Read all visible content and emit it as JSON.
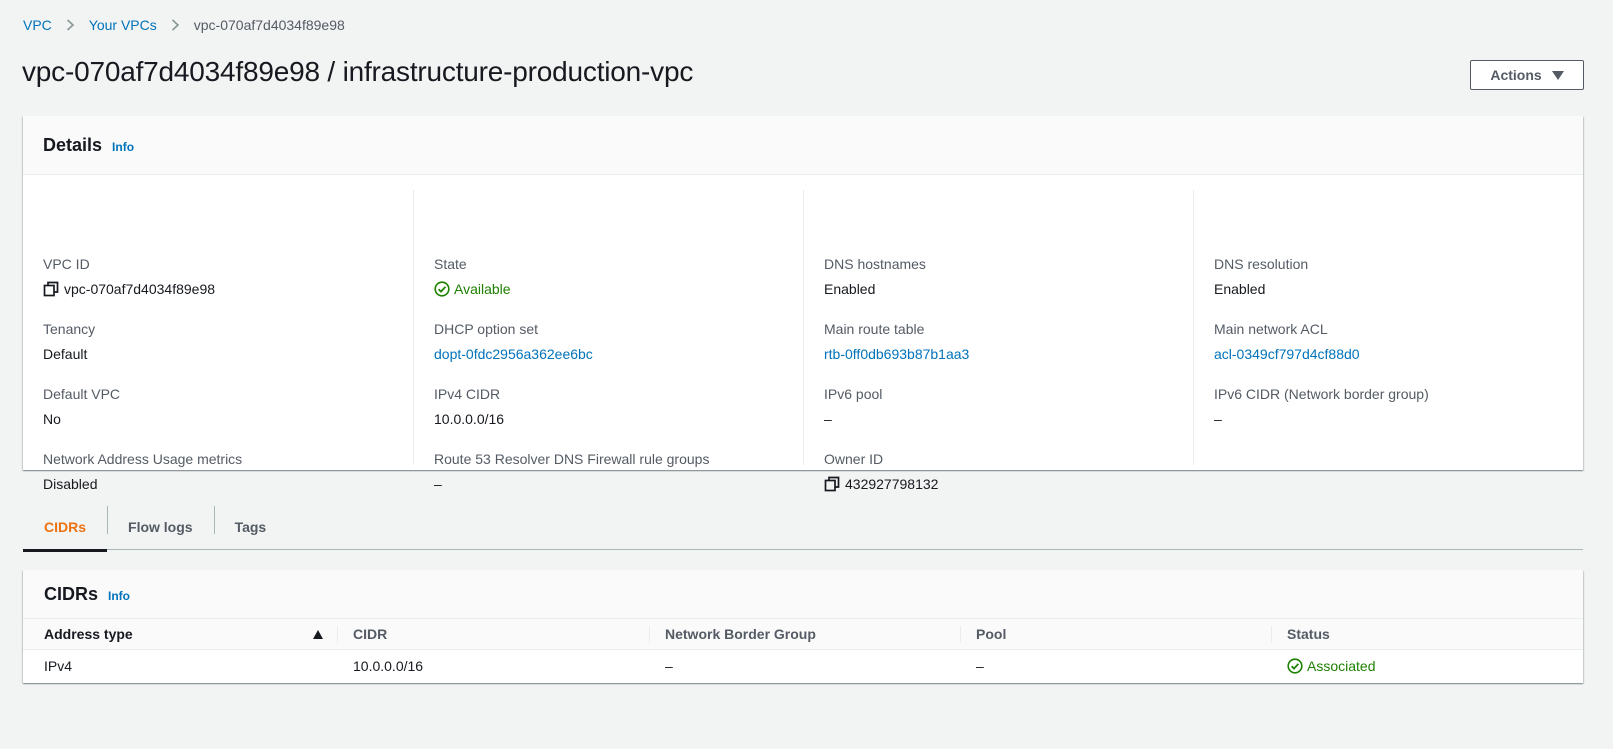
{
  "breadcrumb": {
    "vpc": "VPC",
    "your_vpcs": "Your VPCs",
    "current": "vpc-070af7d4034f89e98"
  },
  "title": "vpc-070af7d4034f89e98 / infrastructure-production-vpc",
  "actions_label": "Actions",
  "details": {
    "heading": "Details",
    "info": "Info",
    "fields": {
      "vpc_id": {
        "label": "VPC ID",
        "value": "vpc-070af7d4034f89e98"
      },
      "tenancy": {
        "label": "Tenancy",
        "value": "Default"
      },
      "default_vpc": {
        "label": "Default VPC",
        "value": "No"
      },
      "nau_metrics": {
        "label": "Network Address Usage metrics",
        "value": "Disabled"
      },
      "state": {
        "label": "State",
        "value": "Available"
      },
      "dhcp": {
        "label": "DHCP option set",
        "value": "dopt-0fdc2956a362ee6bc"
      },
      "ipv4_cidr": {
        "label": "IPv4 CIDR",
        "value": "10.0.0.0/16"
      },
      "route53": {
        "label": "Route 53 Resolver DNS Firewall rule groups",
        "value": "–"
      },
      "dns_hostnames": {
        "label": "DNS hostnames",
        "value": "Enabled"
      },
      "main_route_table": {
        "label": "Main route table",
        "value": "rtb-0ff0db693b87b1aa3"
      },
      "ipv6_pool": {
        "label": "IPv6 pool",
        "value": "–"
      },
      "owner_id": {
        "label": "Owner ID",
        "value": "432927798132"
      },
      "dns_resolution": {
        "label": "DNS resolution",
        "value": "Enabled"
      },
      "main_acl": {
        "label": "Main network ACL",
        "value": "acl-0349cf797d4cf88d0"
      },
      "ipv6_cidr": {
        "label": "IPv6 CIDR (Network border group)",
        "value": "–"
      }
    }
  },
  "tabs": [
    "CIDRs",
    "Flow logs",
    "Tags"
  ],
  "cidrs": {
    "heading": "CIDRs",
    "info": "Info",
    "columns": [
      "Address type",
      "CIDR",
      "Network Border Group",
      "Pool",
      "Status"
    ],
    "rows": [
      [
        "IPv4",
        "10.0.0.0/16",
        "–",
        "–",
        "Associated"
      ]
    ]
  },
  "colors": {
    "link": "#0073bb",
    "success": "#1d8102",
    "active_tab": "#ec7211"
  },
  "icons": [
    "chevron-right-icon",
    "copy-icon",
    "status-success-icon",
    "caret-down-icon",
    "sort-ascending-icon"
  ]
}
